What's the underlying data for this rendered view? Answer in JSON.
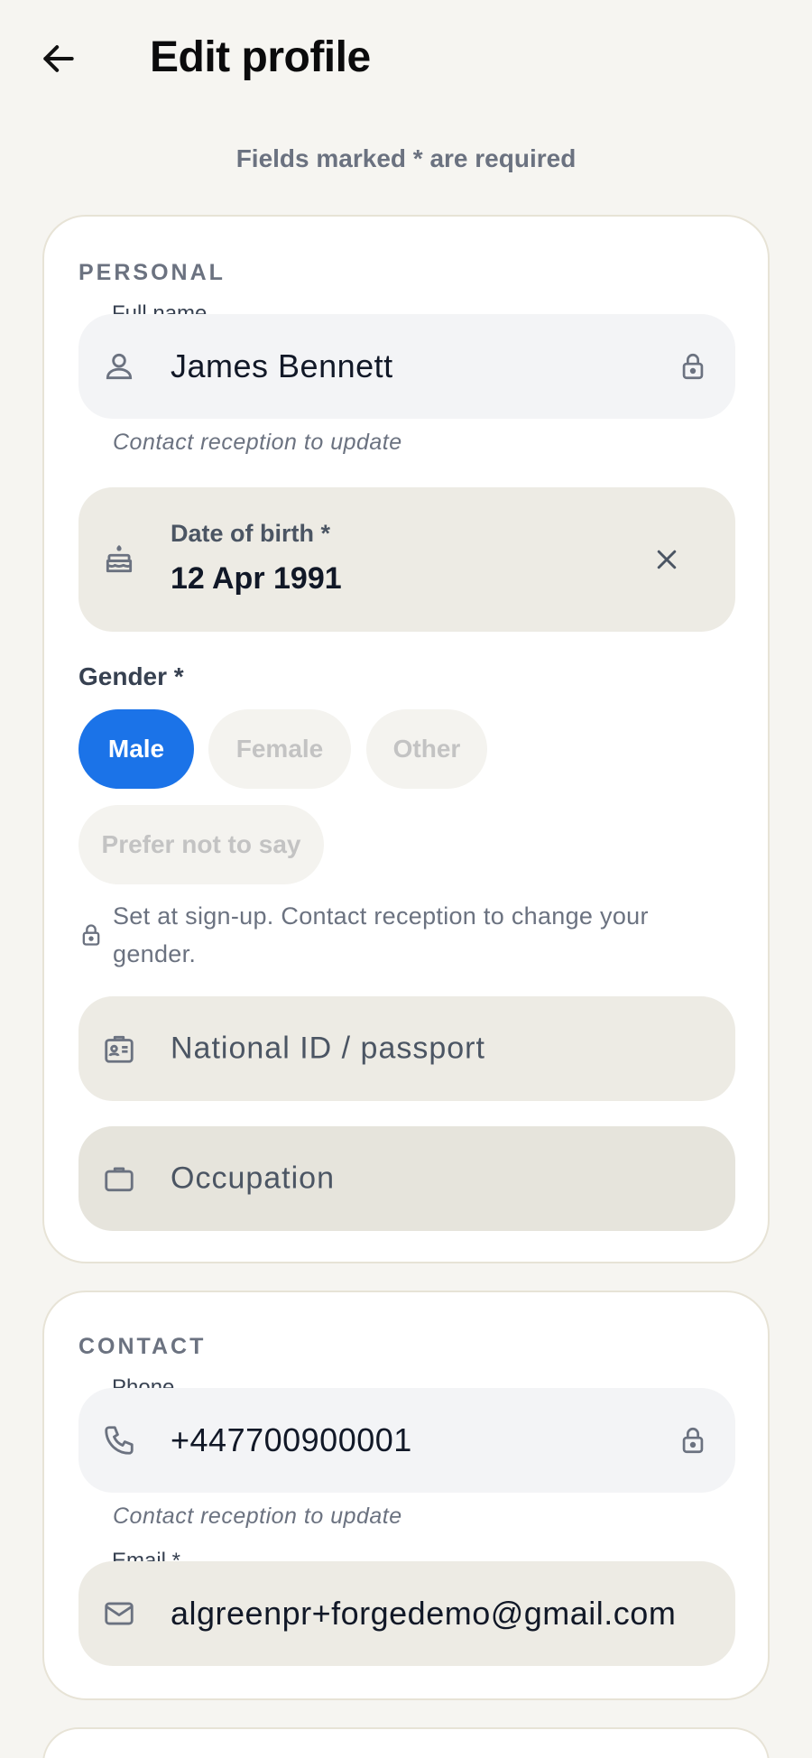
{
  "header": {
    "title": "Edit profile",
    "required_note": "Fields marked * are required"
  },
  "personal": {
    "section_label": "PERSONAL",
    "full_name": {
      "label": "Full name",
      "value": "James Bennett",
      "helper": "Contact reception to update",
      "icon": "person-icon",
      "locked": true
    },
    "dob": {
      "label": "Date of birth *",
      "value": "12 Apr 1991",
      "icon": "cake-icon"
    },
    "gender": {
      "label": "Gender *",
      "options": [
        "Male",
        "Female",
        "Other",
        "Prefer not to say"
      ],
      "selected": "Male",
      "note": "Set at sign-up. Contact reception to change your gender."
    },
    "national_id": {
      "placeholder": "National ID / passport",
      "icon": "id-badge-icon"
    },
    "occupation": {
      "placeholder": "Occupation",
      "icon": "briefcase-icon"
    }
  },
  "contact": {
    "section_label": "CONTACT",
    "phone": {
      "label": "Phone",
      "value": "+447700900001",
      "helper": "Contact reception to update",
      "icon": "phone-icon",
      "locked": true
    },
    "email": {
      "label": "Email *",
      "value": "algreenpr+forgedemo@gmail.com",
      "icon": "mail-icon"
    }
  },
  "colors": {
    "accent": "#1b73e8",
    "page_bg": "#f6f5f1",
    "card_bg": "#ffffff"
  }
}
